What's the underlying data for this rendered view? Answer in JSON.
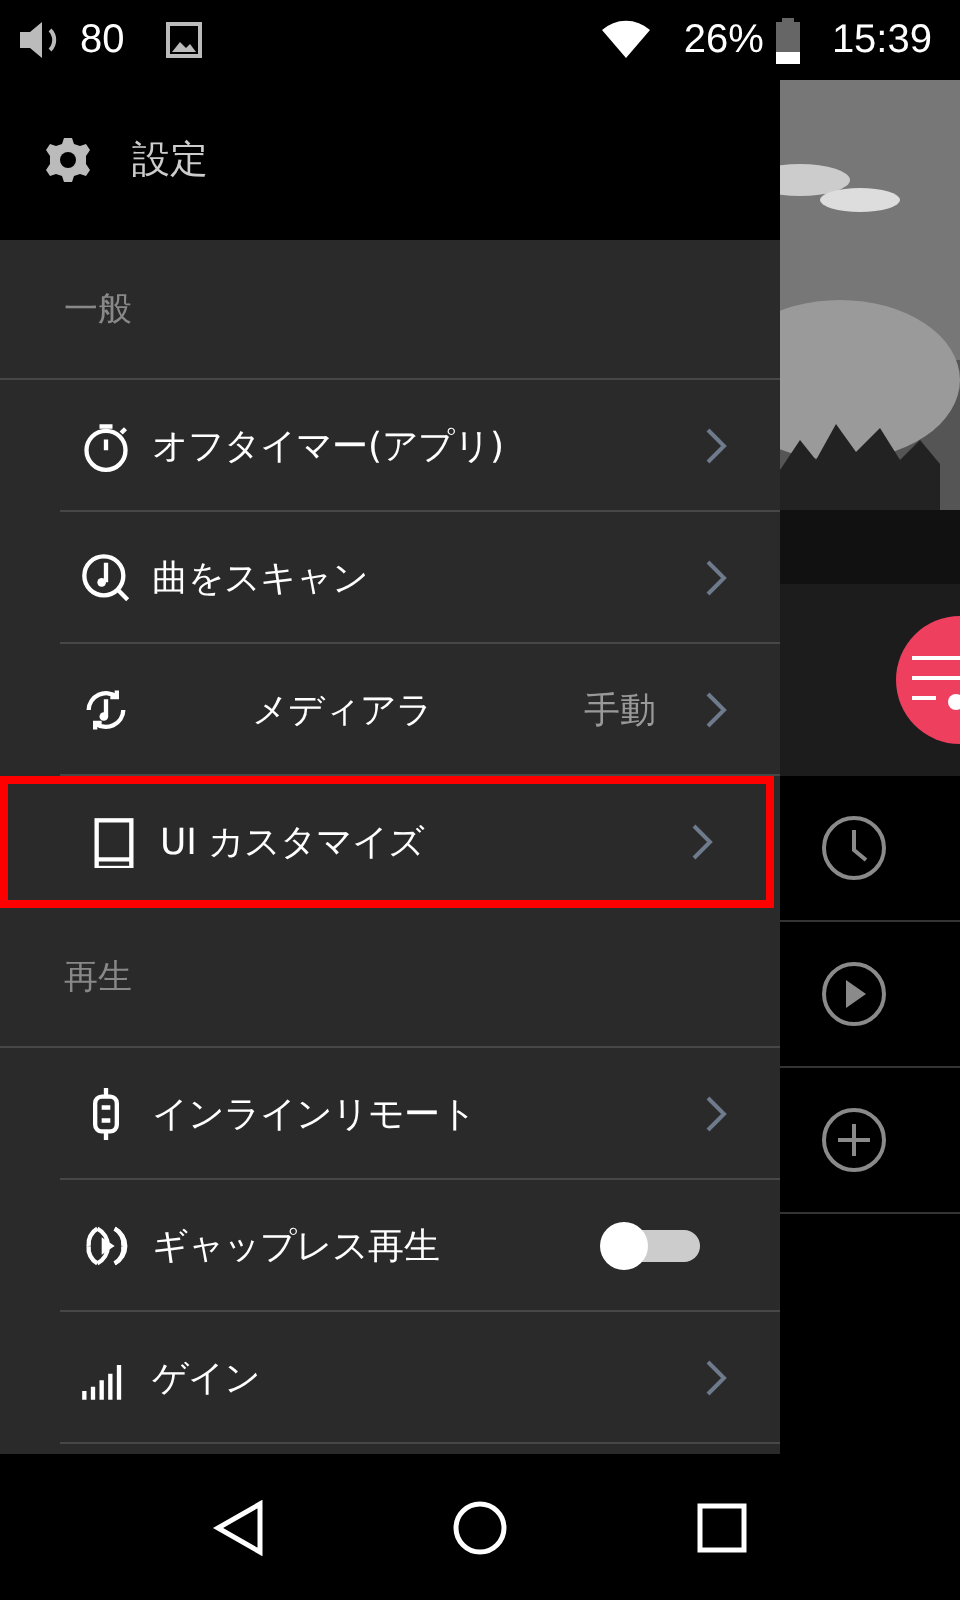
{
  "status_bar": {
    "volume": "80",
    "battery": "26%",
    "time": "15:39"
  },
  "drawer": {
    "title": "設定",
    "sections": [
      {
        "header": "一般",
        "items": [
          {
            "kind": "link",
            "label": "オフタイマー(アプリ)",
            "highlighted": false
          },
          {
            "kind": "link",
            "label": "曲をスキャン",
            "highlighted": false
          },
          {
            "kind": "value",
            "label": "メディアラ",
            "value": "手動",
            "highlighted": false
          },
          {
            "kind": "link",
            "label": "UI カスタマイズ",
            "highlighted": true
          }
        ]
      },
      {
        "header": "再生",
        "items": [
          {
            "kind": "link",
            "label": "インラインリモート",
            "highlighted": false
          },
          {
            "kind": "toggle",
            "label": "ギャップレス再生",
            "on": false,
            "highlighted": false
          },
          {
            "kind": "link",
            "label": "ゲイン",
            "highlighted": false
          }
        ]
      }
    ]
  }
}
